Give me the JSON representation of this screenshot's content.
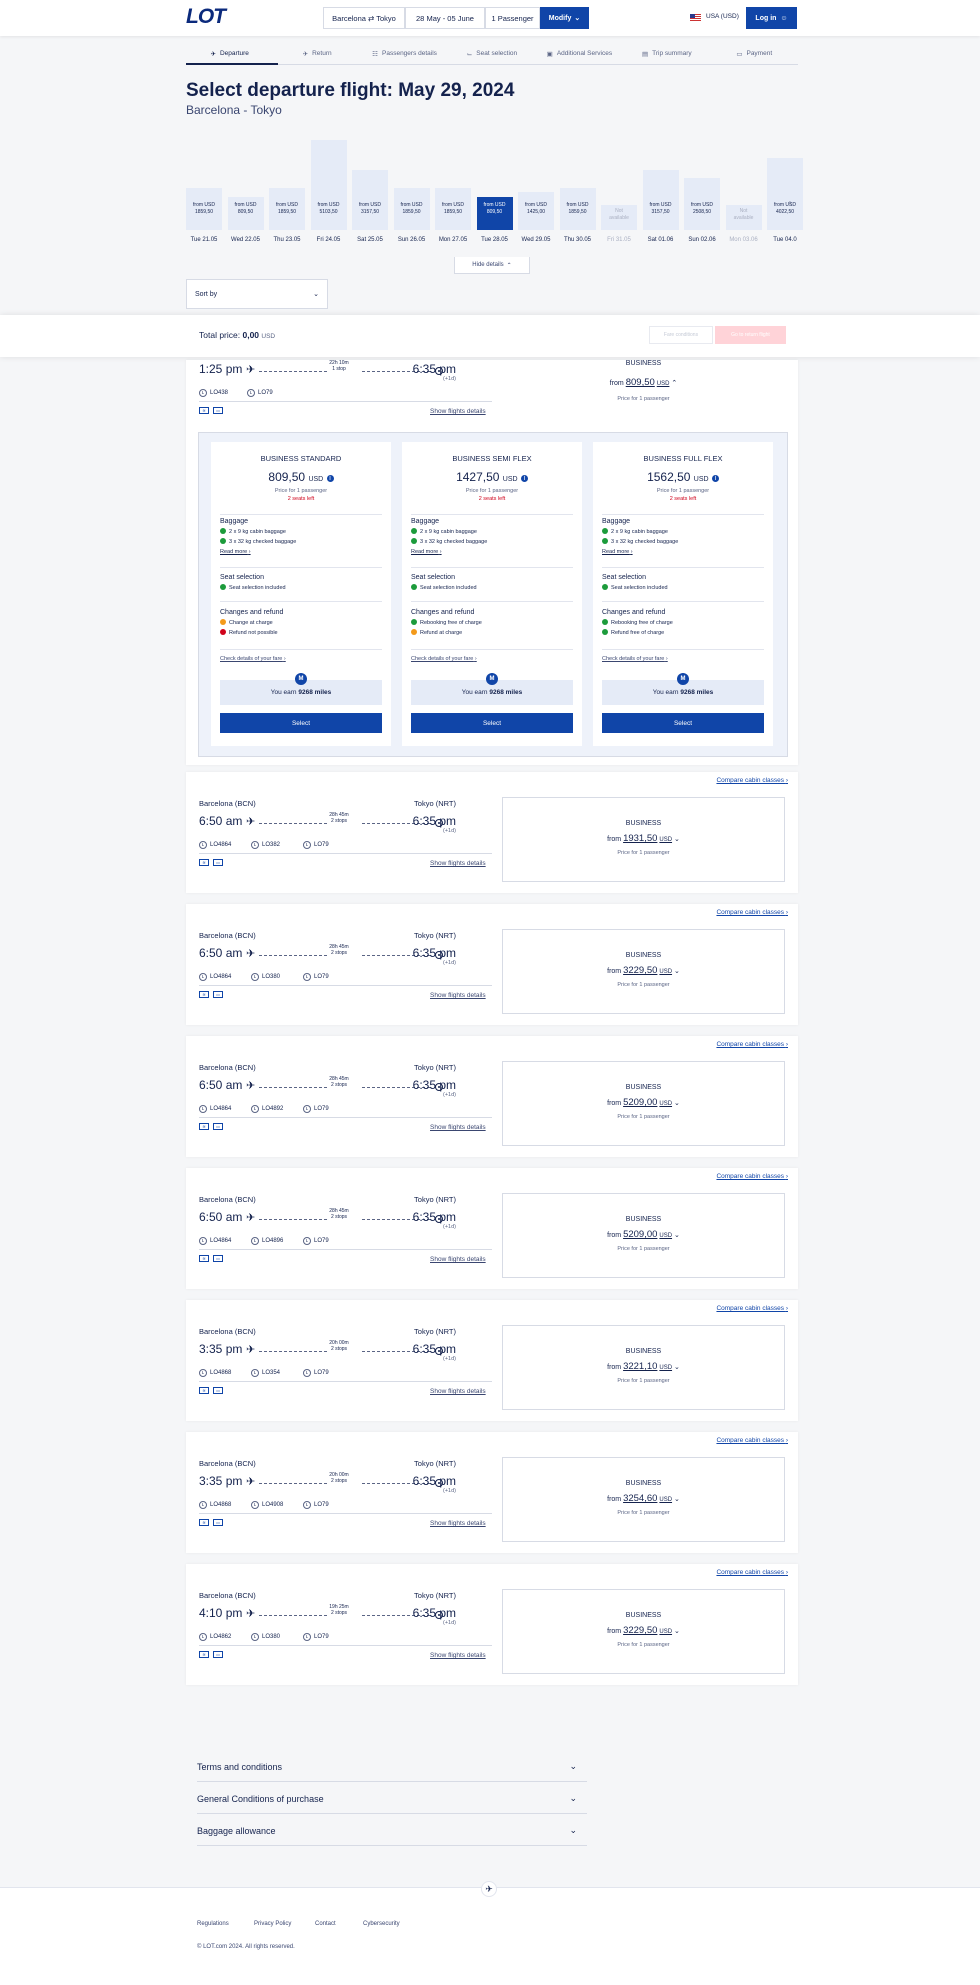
{
  "header": {
    "logo": "LOT",
    "route": "Barcelona ⇄ Tokyo",
    "dates": "28 May - 05 June",
    "passengers": "1 Passenger",
    "modify": "Modify",
    "currency": "USA (USD)",
    "login": "Log in"
  },
  "steps": [
    "Departure",
    "Return",
    "Passengers details",
    "Seat selection",
    "Additional Services",
    "Trip summary",
    "Payment"
  ],
  "title": "Select departure flight: May 29, 2024",
  "subtitle": "Barcelona - Tokyo",
  "dates": [
    {
      "from": "from USD",
      "price": "1859,50",
      "label": "Tue 21.05",
      "level": 0.42,
      "state": "normal"
    },
    {
      "from": "from USD",
      "price": "809,50",
      "label": "Wed 22.05",
      "level": 0.33,
      "state": "normal"
    },
    {
      "from": "from USD",
      "price": "1859,50",
      "label": "Thu 23.05",
      "level": 0.42,
      "state": "normal"
    },
    {
      "from": "from USD",
      "price": "5103,50",
      "label": "Fri 24.05",
      "level": 0.9,
      "state": "normal"
    },
    {
      "from": "from USD",
      "price": "3157,50",
      "label": "Sat 25.05",
      "level": 0.6,
      "state": "normal"
    },
    {
      "from": "from USD",
      "price": "1859,50",
      "label": "Sun 26.05",
      "level": 0.42,
      "state": "normal"
    },
    {
      "from": "from USD",
      "price": "1859,50",
      "label": "Mon 27.05",
      "level": 0.42,
      "state": "normal"
    },
    {
      "from": "from USD",
      "price": "809,50",
      "label": "Tue 28.05",
      "level": 0.33,
      "state": "selected"
    },
    {
      "from": "from USD",
      "price": "1425,00",
      "label": "Wed 29.05",
      "level": 0.38,
      "state": "normal"
    },
    {
      "from": "from USD",
      "price": "1859,50",
      "label": "Thu 30.05",
      "level": 0.42,
      "state": "normal"
    },
    {
      "from": "Not",
      "price": "available",
      "label": "Fri 31.05",
      "level": 0.25,
      "state": "na"
    },
    {
      "from": "from USD",
      "price": "3157,50",
      "label": "Sat 01.06",
      "level": 0.6,
      "state": "normal"
    },
    {
      "from": "from USD",
      "price": "2508,50",
      "label": "Sun 02.06",
      "level": 0.52,
      "state": "normal"
    },
    {
      "from": "Not",
      "price": "available",
      "label": "Mon 03.06",
      "level": 0.25,
      "state": "na"
    },
    {
      "from": "from USD",
      "price": "4022,50",
      "label": "Tue 04.0",
      "level": 0.72,
      "state": "normal"
    }
  ],
  "hide_details": "Hide details",
  "sort": {
    "label": "Sort by"
  },
  "total": {
    "label": "Total price:",
    "value": "0,00",
    "currency": "USD",
    "btn1": "Fare conditions",
    "btn2": "Go to return flight"
  },
  "expanded": {
    "dep": "1:25 pm",
    "arr": "6:35 pm",
    "plus": "(+1d)",
    "dur": "22h 10m",
    "stops": "1 stop",
    "flights": [
      "LO438",
      "LO79"
    ],
    "details": "Show flights details",
    "cabin": "BUSINESS",
    "from": "from",
    "price": "809,50",
    "cur": "USD",
    "note": "Price for 1 passenger",
    "fares": [
      {
        "name": "BUSINESS STANDARD",
        "price": "809,50",
        "cur": "USD",
        "note": "Price for 1 passenger",
        "seats": "2 seats left",
        "baggage": "Baggage",
        "bag1": "2 x 9 kg cabin baggage",
        "bag2": "3 x 32 kg checked baggage",
        "more": "Read more",
        "seat": "Seat selection",
        "seat1": "Seat selection included",
        "changes": "Changes and refund",
        "c1": "Change at charge",
        "c1s": "warn",
        "c2": "Refund not possible",
        "c2s": "no",
        "check": "Check details of your fare",
        "mile_b": "M",
        "miles_pre": "You earn",
        "miles": "9268 miles",
        "select": "Select"
      },
      {
        "name": "BUSINESS SEMI FLEX",
        "price": "1427,50",
        "cur": "USD",
        "note": "Price for 1 passenger",
        "seats": "2 seats left",
        "baggage": "Baggage",
        "bag1": "2 x 9 kg cabin baggage",
        "bag2": "3 x 32 kg checked baggage",
        "more": "Read more",
        "seat": "Seat selection",
        "seat1": "Seat selection included",
        "changes": "Changes and refund",
        "c1": "Rebooking free of charge",
        "c1s": "ok",
        "c2": "Refund at charge",
        "c2s": "warn",
        "check": "Check details of your fare",
        "mile_b": "M",
        "miles_pre": "You earn",
        "miles": "9268 miles",
        "select": "Select"
      },
      {
        "name": "BUSINESS FULL FLEX",
        "price": "1562,50",
        "cur": "USD",
        "note": "Price for 1 passenger",
        "seats": "2 seats left",
        "baggage": "Baggage",
        "bag1": "2 x 9 kg cabin baggage",
        "bag2": "3 x 32 kg checked baggage",
        "more": "Read more",
        "seat": "Seat selection",
        "seat1": "Seat selection included",
        "changes": "Changes and refund",
        "c1": "Rebooking free of charge",
        "c1s": "ok",
        "c2": "Refund free of charge",
        "c2s": "ok",
        "check": "Check details of your fare",
        "mile_b": "M",
        "miles_pre": "You earn",
        "miles": "9268 miles",
        "select": "Select"
      }
    ]
  },
  "flights": [
    {
      "compare": "Compare cabin classes",
      "from": "Barcelona (BCN)",
      "to": "Tokyo (NRT)",
      "dep": "6:50 am",
      "arr": "6:35 pm",
      "plus": "(+1d)",
      "dur": "28h 45m",
      "stops": "2 stops",
      "legs": [
        "LO4864",
        "LO382",
        "LO79"
      ],
      "details": "Show flights details",
      "cabin": "BUSINESS",
      "fromw": "from",
      "price": "1931,50",
      "cur": "USD",
      "note": "Price for 1 passenger"
    },
    {
      "compare": "Compare cabin classes",
      "from": "Barcelona (BCN)",
      "to": "Tokyo (NRT)",
      "dep": "6:50 am",
      "arr": "6:35 pm",
      "plus": "(+1d)",
      "dur": "28h 45m",
      "stops": "2 stops",
      "legs": [
        "LO4864",
        "LO380",
        "LO79"
      ],
      "details": "Show flights details",
      "cabin": "BUSINESS",
      "fromw": "from",
      "price": "3229,50",
      "cur": "USD",
      "note": "Price for 1 passenger"
    },
    {
      "compare": "Compare cabin classes",
      "from": "Barcelona (BCN)",
      "to": "Tokyo (NRT)",
      "dep": "6:50 am",
      "arr": "6:35 pm",
      "plus": "(+1d)",
      "dur": "28h 45m",
      "stops": "2 stops",
      "legs": [
        "LO4864",
        "LO4892",
        "LO79"
      ],
      "details": "Show flights details",
      "cabin": "BUSINESS",
      "fromw": "from",
      "price": "5209,00",
      "cur": "USD",
      "note": "Price for 1 passenger"
    },
    {
      "compare": "Compare cabin classes",
      "from": "Barcelona (BCN)",
      "to": "Tokyo (NRT)",
      "dep": "6:50 am",
      "arr": "6:35 pm",
      "plus": "(+1d)",
      "dur": "28h 45m",
      "stops": "2 stops",
      "legs": [
        "LO4864",
        "LO4896",
        "LO79"
      ],
      "details": "Show flights details",
      "cabin": "BUSINESS",
      "fromw": "from",
      "price": "5209,00",
      "cur": "USD",
      "note": "Price for 1 passenger"
    },
    {
      "compare": "Compare cabin classes",
      "from": "Barcelona (BCN)",
      "to": "Tokyo (NRT)",
      "dep": "3:35 pm",
      "arr": "6:35 pm",
      "plus": "(+1d)",
      "dur": "20h 00m",
      "stops": "2 stops",
      "legs": [
        "LO4868",
        "LO354",
        "LO79"
      ],
      "details": "Show flights details",
      "cabin": "BUSINESS",
      "fromw": "from",
      "price": "3221,10",
      "cur": "USD",
      "note": "Price for 1 passenger"
    },
    {
      "compare": "Compare cabin classes",
      "from": "Barcelona (BCN)",
      "to": "Tokyo (NRT)",
      "dep": "3:35 pm",
      "arr": "6:35 pm",
      "plus": "(+1d)",
      "dur": "20h 00m",
      "stops": "2 stops",
      "legs": [
        "LO4868",
        "LO4908",
        "LO79"
      ],
      "details": "Show flights details",
      "cabin": "BUSINESS",
      "fromw": "from",
      "price": "3254,60",
      "cur": "USD",
      "note": "Price for 1 passenger"
    },
    {
      "compare": "Compare cabin classes",
      "from": "Barcelona (BCN)",
      "to": "Tokyo (NRT)",
      "dep": "4:10 pm",
      "arr": "6:35 pm",
      "plus": "(+1d)",
      "dur": "19h 25m",
      "stops": "2 stops",
      "legs": [
        "LO4862",
        "LO380",
        "LO79"
      ],
      "details": "Show flights details",
      "cabin": "BUSINESS",
      "fromw": "from",
      "price": "3229,50",
      "cur": "USD",
      "note": "Price for 1 passenger"
    }
  ],
  "accordions": [
    "Terms and conditions",
    "General Conditions of purchase",
    "Baggage allowance"
  ],
  "footer": {
    "links": [
      "Regulations",
      "Privacy Policy",
      "Contact",
      "Cybersecurity"
    ],
    "copy": "© LOT.com 2024. All rights reserved."
  }
}
